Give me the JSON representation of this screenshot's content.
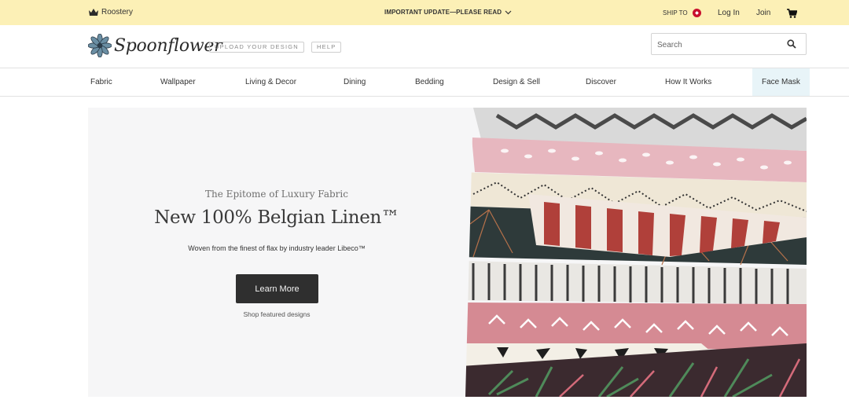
{
  "topbar": {
    "roostery_label": "Roostery",
    "crown_icon": "crown-icon",
    "update_label": "IMPORTANT UPDATE—PLEASE READ",
    "update_chevron_icon": "chevron-down-icon",
    "ship_to_label": "SHIP TO",
    "flag_icon": "canada-flag-icon",
    "login_label": "Log In",
    "join_label": "Join",
    "cart_icon": "cart-icon",
    "bg_color": "#fcf0b6"
  },
  "header": {
    "logo_text": "Spoonflower",
    "logo_icon": "flower-icon",
    "upload_label": "UPLOAD YOUR DESIGN",
    "help_label": "HELP",
    "search_placeholder": "Search",
    "search_value": "",
    "search_icon": "search-icon"
  },
  "nav": {
    "items": [
      {
        "label": "Fabric"
      },
      {
        "label": "Wallpaper"
      },
      {
        "label": "Living & Decor"
      },
      {
        "label": "Dining"
      },
      {
        "label": "Bedding"
      },
      {
        "label": "Design & Sell"
      },
      {
        "label": "Discover"
      },
      {
        "label": "How It Works"
      },
      {
        "label": "Face Mask",
        "highlighted": true
      }
    ],
    "highlight_color": "#e8f4f8"
  },
  "hero": {
    "eyebrow": "The Epitome of Luxury Fabric",
    "headline": "New 100% Belgian Linen™",
    "subhead": "Woven from the finest of flax by industry leader Libeco™",
    "cta_label": "Learn More",
    "secondary_link": "Shop featured designs",
    "cta_color": "#2f2f2f",
    "bg_color": "#f6f6f7"
  }
}
